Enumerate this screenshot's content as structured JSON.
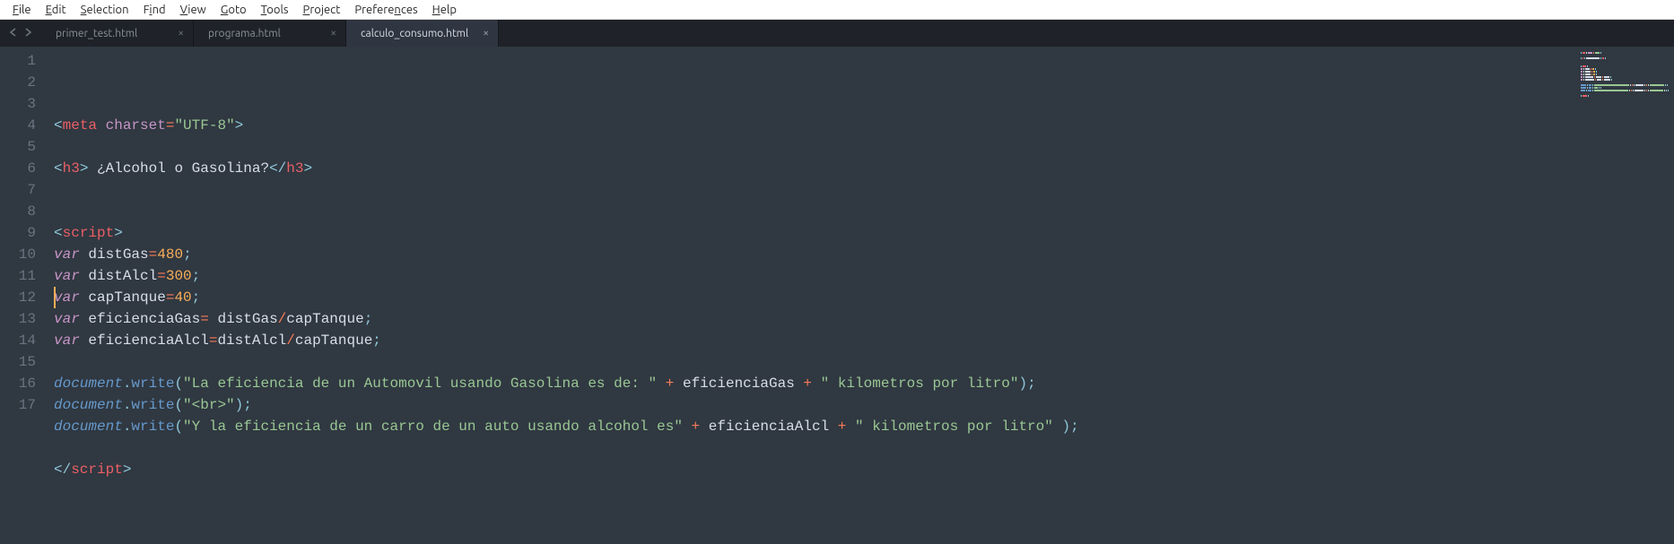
{
  "menubar": {
    "items": [
      {
        "label": "File",
        "mn": "F"
      },
      {
        "label": "Edit",
        "mn": "E"
      },
      {
        "label": "Selection",
        "mn": "S"
      },
      {
        "label": "Find",
        "mn": "i"
      },
      {
        "label": "View",
        "mn": "V"
      },
      {
        "label": "Goto",
        "mn": "G"
      },
      {
        "label": "Tools",
        "mn": "T"
      },
      {
        "label": "Project",
        "mn": "P"
      },
      {
        "label": "Preferences",
        "mn": "n"
      },
      {
        "label": "Help",
        "mn": "H"
      }
    ]
  },
  "tabs": [
    {
      "label": "primer_test.html",
      "active": false
    },
    {
      "label": "programa.html",
      "active": false
    },
    {
      "label": "calculo_consumo.html",
      "active": true
    }
  ],
  "code": {
    "line_count": 17,
    "cursor_line": 12,
    "tokens": [
      [
        [
          "p",
          "<"
        ],
        [
          "tag",
          "meta"
        ],
        [
          "txt",
          " "
        ],
        [
          "attr",
          "charset"
        ],
        [
          "op",
          "="
        ],
        [
          "str",
          "\"UTF-8\""
        ],
        [
          "p",
          ">"
        ]
      ],
      [],
      [
        [
          "p",
          "<"
        ],
        [
          "tag",
          "h3"
        ],
        [
          "p",
          ">"
        ],
        [
          "txt",
          " ¿Alcohol o Gasolina?"
        ],
        [
          "p",
          "</"
        ],
        [
          "tag",
          "h3"
        ],
        [
          "p",
          ">"
        ]
      ],
      [],
      [],
      [
        [
          "p",
          "<"
        ],
        [
          "tag",
          "script"
        ],
        [
          "p",
          ">"
        ]
      ],
      [
        [
          "kw",
          "var"
        ],
        [
          "txt",
          " "
        ],
        [
          "id",
          "distGas"
        ],
        [
          "op",
          "="
        ],
        [
          "num",
          "480"
        ],
        [
          "p",
          ";"
        ]
      ],
      [
        [
          "kw",
          "var"
        ],
        [
          "txt",
          " "
        ],
        [
          "id",
          "distAlcl"
        ],
        [
          "op",
          "="
        ],
        [
          "num",
          "300"
        ],
        [
          "p",
          ";"
        ]
      ],
      [
        [
          "kw",
          "var"
        ],
        [
          "txt",
          " "
        ],
        [
          "id",
          "capTanque"
        ],
        [
          "op",
          "="
        ],
        [
          "num",
          "40"
        ],
        [
          "p",
          ";"
        ]
      ],
      [
        [
          "kw",
          "var"
        ],
        [
          "txt",
          " "
        ],
        [
          "id",
          "eficienciaGas"
        ],
        [
          "op",
          "="
        ],
        [
          "txt",
          " distGas"
        ],
        [
          "op",
          "/"
        ],
        [
          "id",
          "capTanque"
        ],
        [
          "p",
          ";"
        ]
      ],
      [
        [
          "kw",
          "var"
        ],
        [
          "txt",
          " "
        ],
        [
          "id",
          "eficienciaAlcl"
        ],
        [
          "op",
          "="
        ],
        [
          "id",
          "distAlcl"
        ],
        [
          "op",
          "/"
        ],
        [
          "id",
          "capTanque"
        ],
        [
          "p",
          ";"
        ]
      ],
      [],
      [
        [
          "obj",
          "document"
        ],
        [
          "p",
          "."
        ],
        [
          "fn",
          "write"
        ],
        [
          "p",
          "("
        ],
        [
          "str",
          "\"La eficiencia de un Automovil usando Gasolina es de: \""
        ],
        [
          "txt",
          " "
        ],
        [
          "sym",
          "+"
        ],
        [
          "txt",
          " "
        ],
        [
          "id",
          "eficienciaGas"
        ],
        [
          "txt",
          " "
        ],
        [
          "sym",
          "+"
        ],
        [
          "txt",
          " "
        ],
        [
          "str",
          "\" kilometros por litro\""
        ],
        [
          "p",
          ")"
        ],
        [
          "p",
          ";"
        ]
      ],
      [
        [
          "obj",
          "document"
        ],
        [
          "p",
          "."
        ],
        [
          "fn",
          "write"
        ],
        [
          "p",
          "("
        ],
        [
          "str",
          "\"<br>\""
        ],
        [
          "p",
          ")"
        ],
        [
          "p",
          ";"
        ]
      ],
      [
        [
          "obj",
          "document"
        ],
        [
          "p",
          "."
        ],
        [
          "fn",
          "write"
        ],
        [
          "p",
          "("
        ],
        [
          "str",
          "\"Y la eficiencia de un carro de un auto usando alcohol es\""
        ],
        [
          "txt",
          " "
        ],
        [
          "sym",
          "+"
        ],
        [
          "txt",
          " "
        ],
        [
          "id",
          "eficienciaAlcl"
        ],
        [
          "txt",
          " "
        ],
        [
          "sym",
          "+"
        ],
        [
          "txt",
          " "
        ],
        [
          "str",
          "\" kilometros por litro\""
        ],
        [
          "txt",
          " "
        ],
        [
          "p",
          ")"
        ],
        [
          "p",
          ";"
        ]
      ],
      [],
      [
        [
          "p",
          "</"
        ],
        [
          "tag",
          "script"
        ],
        [
          "p",
          ">"
        ]
      ]
    ]
  }
}
